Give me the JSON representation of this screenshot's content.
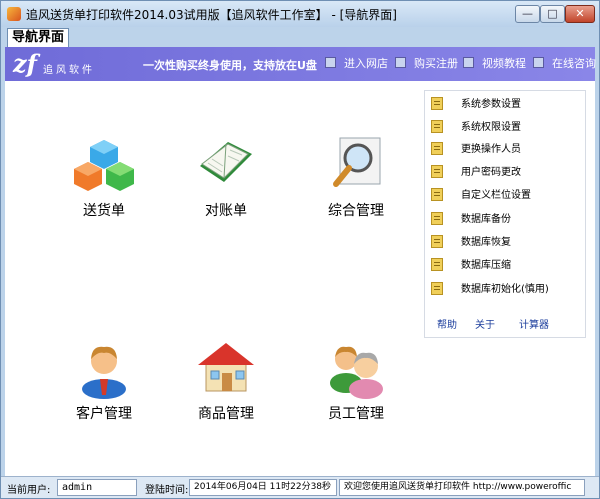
{
  "window": {
    "title": "追风送货单打印软件2014.03试用版【追风软件工作室】 - [导航界面]",
    "controls": {
      "minimize": "—",
      "maximize": "□",
      "close": "✕"
    }
  },
  "tab": {
    "label": "导航界面"
  },
  "banner": {
    "logo_mark": "zf",
    "logo_text": "追风软件",
    "slogan": "一次性购买终身使用，支持放在U盘",
    "links": [
      "进入网店",
      "购买注册",
      "视频教程",
      "在线咨询"
    ]
  },
  "modules": [
    {
      "label": "送货单",
      "icon": "colored-cubes-icon"
    },
    {
      "label": "对账单",
      "icon": "open-book-icon"
    },
    {
      "label": "综合管理",
      "icon": "magnifier-icon"
    },
    {
      "label": "客户管理",
      "icon": "customer-person-icon"
    },
    {
      "label": "商品管理",
      "icon": "house-icon"
    },
    {
      "label": "员工管理",
      "icon": "staff-group-icon"
    }
  ],
  "panel": {
    "items": [
      "系统参数设置",
      "系统权限设置",
      "更换操作人员",
      "用户密码更改",
      "自定义栏位设置",
      "数据库备份",
      "数据库恢复",
      "数据库压缩",
      "数据库初始化(慎用)"
    ],
    "links": [
      "帮助",
      "关于",
      "计算器"
    ]
  },
  "status": {
    "user_label": "当前用户:",
    "user_value": "admin",
    "login_label": "登陆时间:",
    "login_value": "2014年06月04日 11时22分38秒",
    "message": "欢迎您使用追风送货单打印软件 http://www.poweroffic"
  }
}
